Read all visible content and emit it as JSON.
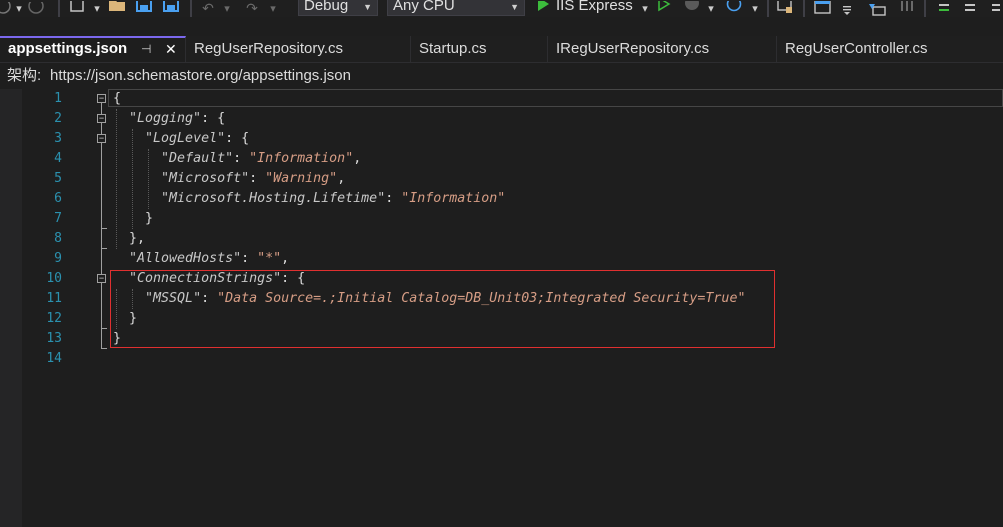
{
  "toolbar": {
    "config": "Debug",
    "platform": "Any CPU",
    "run_target": "IIS Express"
  },
  "tabs": [
    {
      "label": "appsettings.json",
      "active": true
    },
    {
      "label": "RegUserRepository.cs"
    },
    {
      "label": "Startup.cs"
    },
    {
      "label": "IRegUserRepository.cs"
    },
    {
      "label": "RegUserController.cs"
    }
  ],
  "schema": {
    "label": "架构:",
    "url": "https://json.schemastore.org/appsettings.json"
  },
  "editor": {
    "line_numbers": [
      "1",
      "2",
      "3",
      "4",
      "5",
      "6",
      "7",
      "8",
      "9",
      "10",
      "11",
      "12",
      "13",
      "14"
    ],
    "lines": [
      {
        "indent": "",
        "parts": [
          {
            "t": "{",
            "c": "p"
          }
        ]
      },
      {
        "indent": "  ",
        "parts": [
          {
            "t": "\"Logging\"",
            "c": "k"
          },
          {
            "t": ": {",
            "c": "p"
          }
        ]
      },
      {
        "indent": "    ",
        "parts": [
          {
            "t": "\"LogLevel\"",
            "c": "k"
          },
          {
            "t": ": {",
            "c": "p"
          }
        ]
      },
      {
        "indent": "      ",
        "parts": [
          {
            "t": "\"Default\"",
            "c": "k"
          },
          {
            "t": ": ",
            "c": "p"
          },
          {
            "t": "\"Information\"",
            "c": "s"
          },
          {
            "t": ",",
            "c": "p"
          }
        ]
      },
      {
        "indent": "      ",
        "parts": [
          {
            "t": "\"Microsoft\"",
            "c": "k"
          },
          {
            "t": ": ",
            "c": "p"
          },
          {
            "t": "\"Warning\"",
            "c": "s"
          },
          {
            "t": ",",
            "c": "p"
          }
        ]
      },
      {
        "indent": "      ",
        "parts": [
          {
            "t": "\"Microsoft.Hosting.Lifetime\"",
            "c": "k"
          },
          {
            "t": ": ",
            "c": "p"
          },
          {
            "t": "\"Information\"",
            "c": "s"
          }
        ]
      },
      {
        "indent": "    ",
        "parts": [
          {
            "t": "}",
            "c": "p"
          }
        ]
      },
      {
        "indent": "  ",
        "parts": [
          {
            "t": "},",
            "c": "p"
          }
        ]
      },
      {
        "indent": "  ",
        "parts": [
          {
            "t": "\"AllowedHosts\"",
            "c": "k"
          },
          {
            "t": ": ",
            "c": "p"
          },
          {
            "t": "\"*\"",
            "c": "s"
          },
          {
            "t": ",",
            "c": "p"
          }
        ]
      },
      {
        "indent": "  ",
        "parts": [
          {
            "t": "\"ConnectionStrings\"",
            "c": "k"
          },
          {
            "t": ": {",
            "c": "p"
          }
        ]
      },
      {
        "indent": "    ",
        "parts": [
          {
            "t": "\"MSSQL\"",
            "c": "k"
          },
          {
            "t": ": ",
            "c": "p"
          },
          {
            "t": "\"Data Source=.;Initial Catalog=DB_Unit03;Integrated Security=True\"",
            "c": "s"
          }
        ]
      },
      {
        "indent": "  ",
        "parts": [
          {
            "t": "}",
            "c": "p"
          }
        ]
      },
      {
        "indent": "",
        "parts": [
          {
            "t": "}",
            "c": "p"
          }
        ]
      },
      {
        "indent": "",
        "parts": []
      }
    ]
  },
  "colors": {
    "line_number": "#2b91af",
    "tab_accent": "#7b68ee",
    "highlight_border": "#e03030",
    "play_green": "#3cbc3c"
  }
}
